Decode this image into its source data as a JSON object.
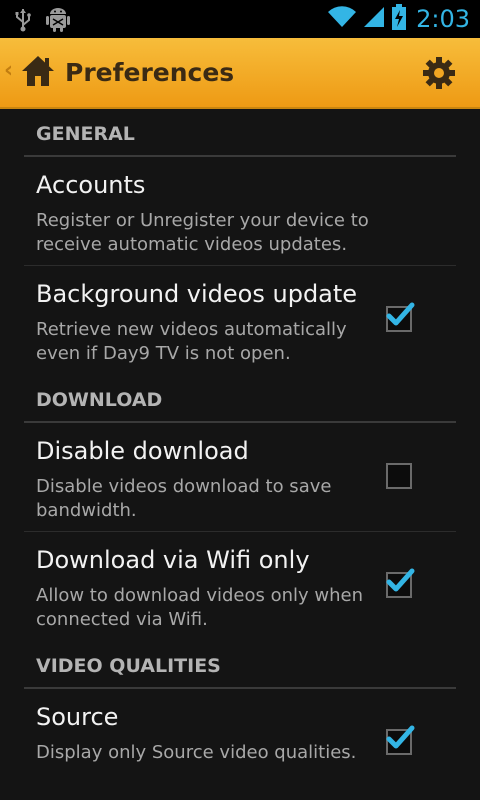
{
  "status_bar": {
    "time": "2:03",
    "icons": [
      "usb-icon",
      "android-debug-icon",
      "wifi-icon",
      "signal-icon",
      "battery-charging-icon"
    ]
  },
  "action_bar": {
    "title": "Preferences",
    "icons": [
      "up-caret-icon",
      "home-icon",
      "settings-gear-icon"
    ]
  },
  "colors": {
    "accent": "#33b5e5",
    "action_bar": "#f2a622",
    "background": "#141414"
  },
  "sections": [
    {
      "header": "GENERAL",
      "items": [
        {
          "title": "Accounts",
          "summary": "Register or Unregister your device to receive automatic videos updates.",
          "checkbox": null
        },
        {
          "title": "Background videos update",
          "summary": "Retrieve new videos automatically even if Day9 TV is not open.",
          "checkbox": true
        }
      ]
    },
    {
      "header": "DOWNLOAD",
      "items": [
        {
          "title": "Disable download",
          "summary": "Disable videos download to save bandwidth.",
          "checkbox": false
        },
        {
          "title": "Download via Wifi only",
          "summary": "Allow to download videos only when connected via Wifi.",
          "checkbox": true
        }
      ]
    },
    {
      "header": "VIDEO QUALITIES",
      "items": [
        {
          "title": "Source",
          "summary": "Display only Source video qualities.",
          "checkbox": true
        }
      ]
    }
  ]
}
